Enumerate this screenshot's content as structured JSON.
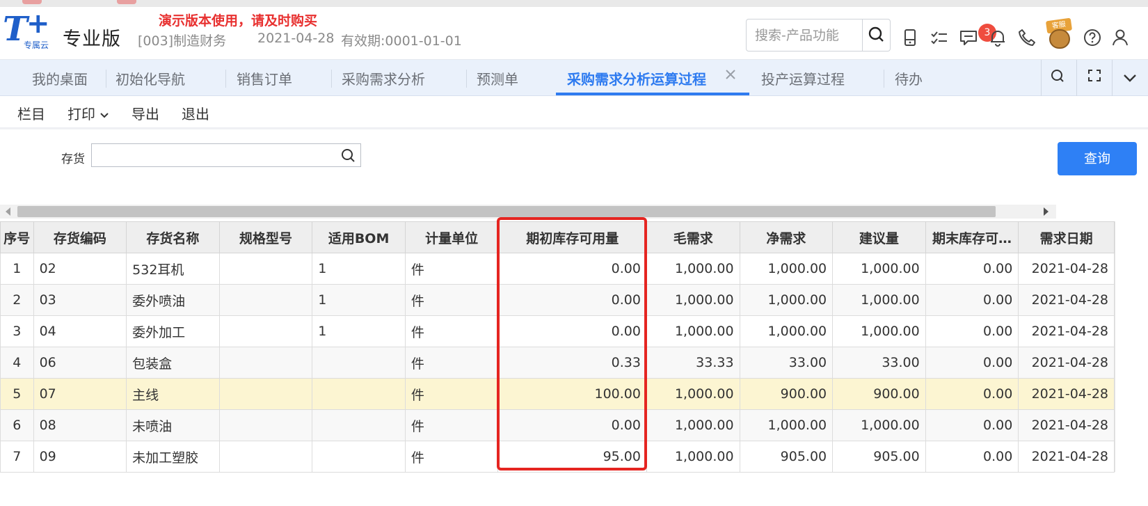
{
  "header": {
    "logo_cloud_text": "专属云",
    "edition": "专业版",
    "demo_notice": "演示版本使用，请及时购买",
    "company": "[003]制造财务",
    "date": "2021-04-28",
    "validity": "有效期:0001-01-01",
    "search_placeholder": "搜索-产品功能",
    "message_count": "3",
    "mascot_sign": "客服"
  },
  "tabs": [
    {
      "label": "我的桌面"
    },
    {
      "label": "初始化导航"
    },
    {
      "label": "销售订单"
    },
    {
      "label": "采购需求分析"
    },
    {
      "label": "预测单"
    },
    {
      "label": "采购需求分析运算过程"
    },
    {
      "label": "投产运算过程"
    },
    {
      "label": "待办"
    }
  ],
  "toolbar": {
    "columns": "栏目",
    "print": "打印",
    "export": "导出",
    "exit": "退出"
  },
  "filter": {
    "inventory_label": "存货",
    "inventory_value": "",
    "query_button": "查询"
  },
  "grid": {
    "columns": [
      "序号",
      "存货编码",
      "存货名称",
      "规格型号",
      "适用BOM",
      "计量单位",
      "期初库存可用量",
      "毛需求",
      "净需求",
      "建议量",
      "期末库存可…",
      "需求日期"
    ],
    "rows": [
      [
        "1",
        "02",
        "532耳机",
        "",
        "1",
        "件",
        "0.00",
        "1,000.00",
        "1,000.00",
        "1,000.00",
        "0.00",
        "2021-04-28"
      ],
      [
        "2",
        "03",
        "委外喷油",
        "",
        "1",
        "件",
        "0.00",
        "1,000.00",
        "1,000.00",
        "1,000.00",
        "0.00",
        "2021-04-28"
      ],
      [
        "3",
        "04",
        "委外加工",
        "",
        "1",
        "件",
        "0.00",
        "1,000.00",
        "1,000.00",
        "1,000.00",
        "0.00",
        "2021-04-28"
      ],
      [
        "4",
        "06",
        "包装盒",
        "",
        "",
        "件",
        "0.33",
        "33.33",
        "33.00",
        "33.00",
        "0.00",
        "2021-04-28"
      ],
      [
        "5",
        "07",
        "主线",
        "",
        "",
        "件",
        "100.00",
        "1,000.00",
        "900.00",
        "900.00",
        "0.00",
        "2021-04-28"
      ],
      [
        "6",
        "08",
        "未喷油",
        "",
        "",
        "件",
        "0.00",
        "1,000.00",
        "1,000.00",
        "1,000.00",
        "0.00",
        "2021-04-28"
      ],
      [
        "7",
        "09",
        "未加工塑胶",
        "",
        "",
        "件",
        "95.00",
        "1,000.00",
        "905.00",
        "905.00",
        "0.00",
        "2021-04-28"
      ]
    ],
    "selected_row": 4,
    "highlight_color": "#e52521"
  },
  "colors": {
    "brand": "#1f5fc9",
    "accent": "#2e7bf0",
    "notice": "#e8302f",
    "selected_row": "#fcf5d2"
  }
}
